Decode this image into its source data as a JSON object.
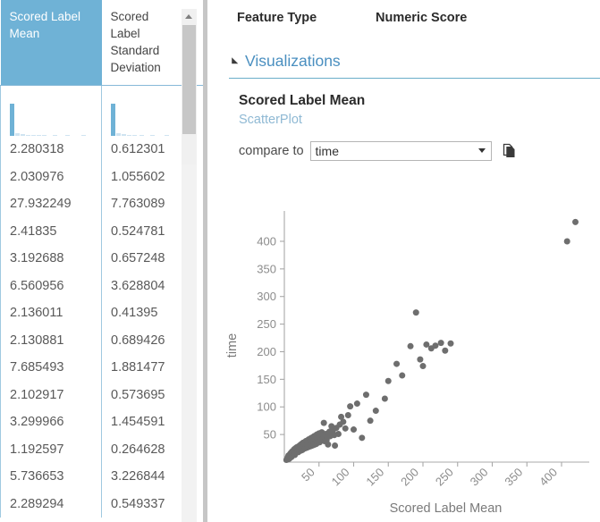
{
  "grid": {
    "columns": [
      {
        "label": "Scored Label Mean",
        "selected": true
      },
      {
        "label": "Scored Label Standard Deviation",
        "selected": false
      }
    ],
    "rows": [
      {
        "c0": "2.280318",
        "c1": "0.612301"
      },
      {
        "c0": "2.030976",
        "c1": "1.055602"
      },
      {
        "c0": "27.932249",
        "c1": "7.763089"
      },
      {
        "c0": "2.41835",
        "c1": "0.524781"
      },
      {
        "c0": "3.192688",
        "c1": "0.657248"
      },
      {
        "c0": "6.560956",
        "c1": "3.628804"
      },
      {
        "c0": "2.136011",
        "c1": "0.41395"
      },
      {
        "c0": "2.130881",
        "c1": "0.689426"
      },
      {
        "c0": "7.685493",
        "c1": "1.881477"
      },
      {
        "c0": "2.102917",
        "c1": "0.573695"
      },
      {
        "c0": "3.299966",
        "c1": "1.454591"
      },
      {
        "c0": "1.192597",
        "c1": "0.264628"
      },
      {
        "c0": "5.736653",
        "c1": "3.226844"
      },
      {
        "c0": "2.289294",
        "c1": "0.549337"
      }
    ],
    "scrollbar": {
      "up_arrow_icon": "scroll-up-arrow-icon"
    },
    "accent_color": "#6fb2d6"
  },
  "right": {
    "column_headers": [
      "Feature Type",
      "Numeric Score"
    ],
    "visualizations": {
      "section_label": "Visualizations",
      "collapse_icon": "triangle-collapse-icon",
      "accent_color": "#4a8fc0"
    },
    "chart_title": "Scored Label Mean",
    "chart_subtitle": "ScatterPlot",
    "compare": {
      "label": "compare to",
      "selected": "time",
      "options": [
        "time"
      ],
      "caret_icon": "chevron-down-icon",
      "copy_icon": "copy-page-icon"
    }
  },
  "chart_data": {
    "type": "scatter",
    "title": "Scored Label Mean",
    "subtitle": "ScatterPlot",
    "xlabel": "Scored Label Mean",
    "ylabel": "time",
    "xlim": [
      0,
      440
    ],
    "ylim": [
      0,
      455
    ],
    "xticks": [
      50,
      100,
      150,
      200,
      250,
      300,
      350,
      400
    ],
    "yticks": [
      50,
      100,
      150,
      200,
      250,
      300,
      350,
      400
    ],
    "xtick_rotation_deg": 45,
    "grid": false,
    "legend": null,
    "marker_color": "#6e6e6e",
    "marker_size_px": 7,
    "points": [
      [
        3,
        4
      ],
      [
        4,
        6
      ],
      [
        5,
        5
      ],
      [
        5,
        9
      ],
      [
        6,
        7
      ],
      [
        6,
        12
      ],
      [
        7,
        6
      ],
      [
        7,
        10
      ],
      [
        8,
        8
      ],
      [
        8,
        14
      ],
      [
        9,
        11
      ],
      [
        9,
        16
      ],
      [
        10,
        9
      ],
      [
        10,
        13
      ],
      [
        11,
        15
      ],
      [
        11,
        19
      ],
      [
        12,
        12
      ],
      [
        12,
        17
      ],
      [
        13,
        14
      ],
      [
        13,
        21
      ],
      [
        14,
        16
      ],
      [
        14,
        23
      ],
      [
        15,
        13
      ],
      [
        15,
        18
      ],
      [
        16,
        20
      ],
      [
        16,
        25
      ],
      [
        17,
        17
      ],
      [
        17,
        22
      ],
      [
        18,
        19
      ],
      [
        18,
        27
      ],
      [
        19,
        21
      ],
      [
        19,
        24
      ],
      [
        20,
        18
      ],
      [
        20,
        26
      ],
      [
        21,
        22
      ],
      [
        21,
        29
      ],
      [
        22,
        20
      ],
      [
        22,
        25
      ],
      [
        23,
        23
      ],
      [
        23,
        31
      ],
      [
        24,
        21
      ],
      [
        24,
        27
      ],
      [
        25,
        24
      ],
      [
        25,
        33
      ],
      [
        26,
        22
      ],
      [
        26,
        28
      ],
      [
        27,
        26
      ],
      [
        27,
        35
      ],
      [
        28,
        24
      ],
      [
        28,
        30
      ],
      [
        29,
        27
      ],
      [
        29,
        36
      ],
      [
        30,
        25
      ],
      [
        30,
        31
      ],
      [
        31,
        28
      ],
      [
        31,
        38
      ],
      [
        32,
        26
      ],
      [
        32,
        33
      ],
      [
        33,
        29
      ],
      [
        33,
        39
      ],
      [
        34,
        27
      ],
      [
        34,
        34
      ],
      [
        35,
        30
      ],
      [
        35,
        41
      ],
      [
        36,
        28
      ],
      [
        36,
        35
      ],
      [
        37,
        31
      ],
      [
        37,
        42
      ],
      [
        38,
        29
      ],
      [
        38,
        36
      ],
      [
        39,
        32
      ],
      [
        39,
        44
      ],
      [
        40,
        30
      ],
      [
        40,
        38
      ],
      [
        41,
        33
      ],
      [
        41,
        45
      ],
      [
        42,
        31
      ],
      [
        42,
        39
      ],
      [
        43,
        34
      ],
      [
        43,
        47
      ],
      [
        44,
        32
      ],
      [
        44,
        40
      ],
      [
        45,
        36
      ],
      [
        45,
        48
      ],
      [
        46,
        33
      ],
      [
        46,
        42
      ],
      [
        47,
        37
      ],
      [
        47,
        50
      ],
      [
        48,
        35
      ],
      [
        48,
        43
      ],
      [
        49,
        38
      ],
      [
        50,
        45
      ],
      [
        50,
        52
      ],
      [
        51,
        36
      ],
      [
        52,
        47
      ],
      [
        53,
        40
      ],
      [
        54,
        54
      ],
      [
        55,
        42
      ],
      [
        56,
        49
      ],
      [
        57,
        71
      ],
      [
        58,
        38
      ],
      [
        59,
        44
      ],
      [
        60,
        51
      ],
      [
        61,
        40
      ],
      [
        62,
        46
      ],
      [
        63,
        32
      ],
      [
        65,
        55
      ],
      [
        66,
        47
      ],
      [
        68,
        65
      ],
      [
        70,
        57
      ],
      [
        72,
        49
      ],
      [
        73,
        30
      ],
      [
        75,
        62
      ],
      [
        78,
        51
      ],
      [
        80,
        68
      ],
      [
        82,
        82
      ],
      [
        85,
        73
      ],
      [
        88,
        61
      ],
      [
        92,
        85
      ],
      [
        95,
        101
      ],
      [
        100,
        59
      ],
      [
        105,
        106
      ],
      [
        112,
        44
      ],
      [
        118,
        122
      ],
      [
        124,
        75
      ],
      [
        132,
        93
      ],
      [
        145,
        115
      ],
      [
        150,
        147
      ],
      [
        162,
        178
      ],
      [
        170,
        157
      ],
      [
        182,
        210
      ],
      [
        190,
        271
      ],
      [
        196,
        186
      ],
      [
        200,
        174
      ],
      [
        205,
        213
      ],
      [
        212,
        206
      ],
      [
        218,
        211
      ],
      [
        226,
        216
      ],
      [
        232,
        202
      ],
      [
        240,
        215
      ],
      [
        408,
        400
      ],
      [
        420,
        435
      ]
    ]
  }
}
